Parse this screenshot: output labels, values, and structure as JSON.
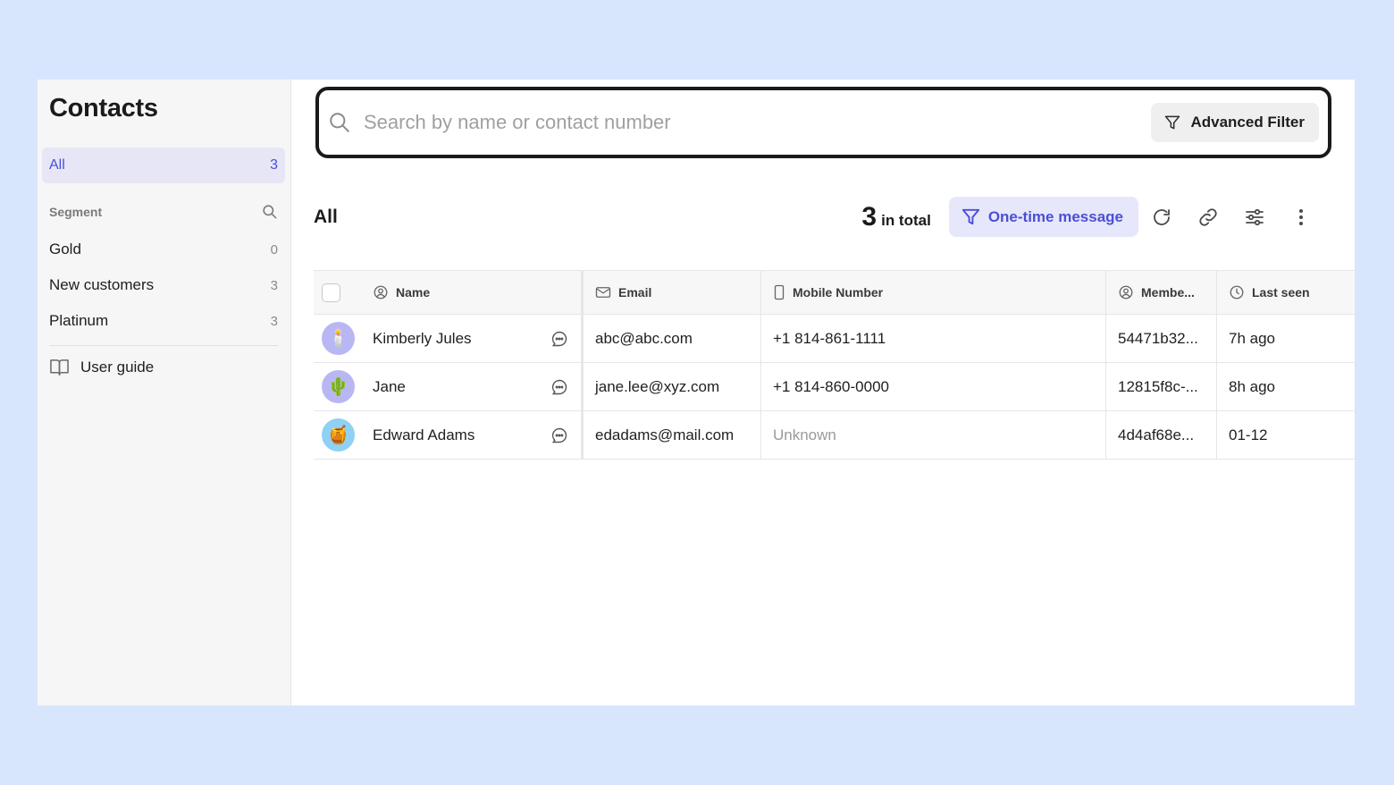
{
  "sidebar": {
    "title": "Contacts",
    "all": {
      "label": "All",
      "count": "3"
    },
    "segment_heading": "Segment",
    "segments": [
      {
        "label": "Gold",
        "count": "0"
      },
      {
        "label": "New customers",
        "count": "3"
      },
      {
        "label": "Platinum",
        "count": "3"
      }
    ],
    "user_guide": "User guide"
  },
  "search": {
    "placeholder": "Search by name or contact number",
    "advanced_filter": "Advanced Filter"
  },
  "toolbar": {
    "title": "All",
    "total_number": "3",
    "total_label": "in total",
    "one_time_message": "One-time message"
  },
  "table": {
    "headers": {
      "name": "Name",
      "email": "Email",
      "mobile": "Mobile Number",
      "member": "Membe...",
      "last_seen": "Last seen"
    },
    "rows": [
      {
        "avatar": "🕯️",
        "avatar_bg": "#b9b7f3",
        "name": "Kimberly Jules",
        "email": "abc@abc.com",
        "mobile": "+1 814-861-1111",
        "member": "54471b32...",
        "last_seen": "7h ago"
      },
      {
        "avatar": "🌵",
        "avatar_bg": "#b9b7f3",
        "name": "Jane",
        "email": "jane.lee@xyz.com",
        "mobile": "+1 814-860-0000",
        "member": "12815f8c-...",
        "last_seen": "8h ago"
      },
      {
        "avatar": "🍯",
        "avatar_bg": "#8fd0f5",
        "name": "Edward Adams",
        "email": "edadams@mail.com",
        "mobile": "Unknown",
        "member": "4d4af68e...",
        "last_seen": "01-12"
      }
    ]
  },
  "colors": {
    "page_bg": "#d7e6fd",
    "accent": "#4a4fd6",
    "accent_bg": "#e7e7fb"
  }
}
